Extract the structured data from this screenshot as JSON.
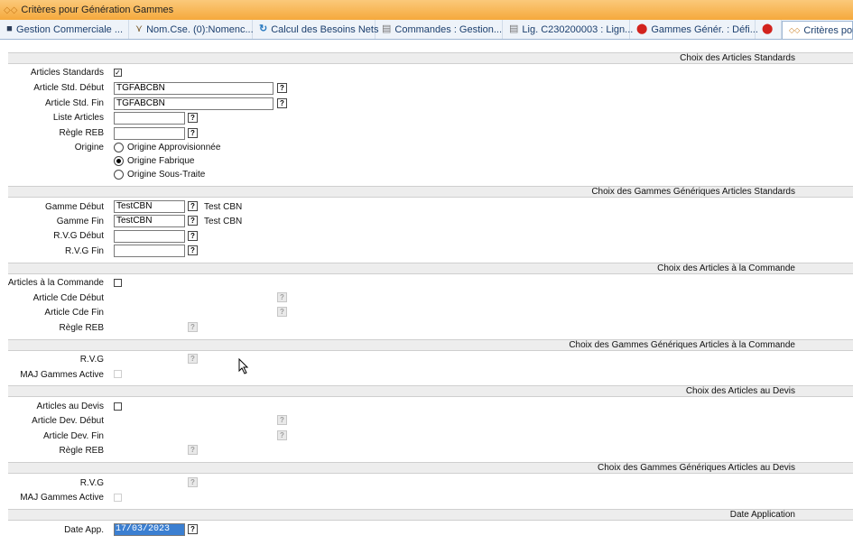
{
  "window": {
    "title": "Critères pour Génération Gammes"
  },
  "tabs": [
    {
      "label": "Gestion Commerciale ..."
    },
    {
      "label": "Nom.Cse. (0):Nomenc..."
    },
    {
      "label": "Calcul des Besoins Nets"
    },
    {
      "label": "Commandes : Gestion..."
    },
    {
      "label": "Lig. C230200003 : Lign..."
    },
    {
      "label": "Gammes Génér. : Défi..."
    },
    {
      "label": ""
    },
    {
      "label": "Critères pour"
    }
  ],
  "sections": {
    "std": "Choix des Articles Standards",
    "gam_std": "Choix des Gammes Génériques Articles Standards",
    "cmd": "Choix des Articles à la Commande",
    "gam_cmd": "Choix des Gammes Génériques Articles à la Commande",
    "devis": "Choix des Articles au Devis",
    "gam_devis": "Choix des Gammes Génériques Articles au Devis",
    "date": "Date Application"
  },
  "help_glyph": "?",
  "check_glyph": "✓",
  "std": {
    "articles_standards_label": "Articles Standards",
    "articles_standards_checked": true,
    "article_debut_label": "Article Std. Début",
    "article_debut_value": "TGFABCBN",
    "article_fin_label": "Article Std. Fin",
    "article_fin_value": "TGFABCBN",
    "liste_label": "Liste Articles",
    "liste_value": "",
    "regle_label": "Règle REB",
    "regle_value": "",
    "origine_label": "Origine",
    "origine_options": [
      "Origine Approvisionnée",
      "Origine Fabrique",
      "Origine Sous-Traite"
    ],
    "origine_selected": "Origine Fabrique"
  },
  "gam_std": {
    "gamme_debut_label": "Gamme Début",
    "gamme_debut_value": "TestCBN",
    "gamme_debut_desc": "Test CBN",
    "gamme_fin_label": "Gamme Fin",
    "gamme_fin_value": "TestCBN",
    "gamme_fin_desc": "Test CBN",
    "rvg_debut_label": "R.V.G Début",
    "rvg_debut_value": "",
    "rvg_fin_label": "R.V.G Fin",
    "rvg_fin_value": ""
  },
  "cmd": {
    "articles_label": "Articles à la Commande",
    "articles_checked": false,
    "article_debut_label": "Article Cde Début",
    "article_fin_label": "Article Cde Fin",
    "regle_label": "Règle REB"
  },
  "gam_cmd": {
    "rvg_label": "R.V.G",
    "maj_label": "MAJ Gammes Active"
  },
  "devis": {
    "articles_label": "Articles au Devis",
    "articles_checked": false,
    "article_debut_label": "Article Dev. Début",
    "article_fin_label": "Article Dev. Fin",
    "regle_label": "Règle REB"
  },
  "gam_devis": {
    "rvg_label": "R.V.G",
    "maj_label": "MAJ Gammes Active"
  },
  "date": {
    "date_app_label": "Date App.",
    "date_app_value": "17/03/2023"
  },
  "colors": {
    "title_bar": "#f5a93c",
    "tab_text": "#1c3f6e",
    "selection": "#3b7fd1"
  }
}
